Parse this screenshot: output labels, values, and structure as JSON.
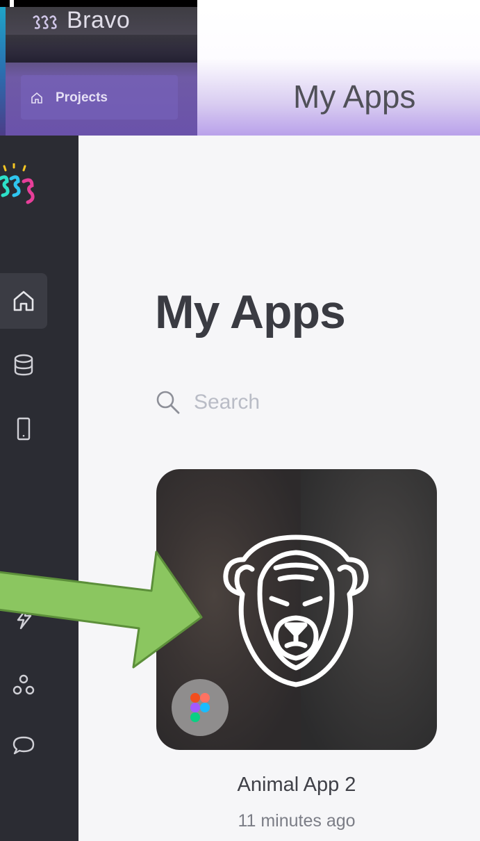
{
  "banner": {
    "brand": "Bravo",
    "projects_label": "Projects",
    "title": "My Apps"
  },
  "sidebar": {
    "items": [
      {
        "icon": "home-icon",
        "active": true
      },
      {
        "icon": "database-icon",
        "active": false
      },
      {
        "icon": "mobile-device-icon",
        "active": false
      },
      {
        "icon": "lightning-icon",
        "active": false
      },
      {
        "icon": "team-icon",
        "active": false
      },
      {
        "icon": "chat-icon",
        "active": false
      }
    ]
  },
  "main": {
    "title": "My Apps",
    "search": {
      "placeholder": "Search"
    },
    "apps": [
      {
        "name": "Animal App 2",
        "updated": "11 minutes ago",
        "badge_icon": "figma-icon"
      }
    ]
  },
  "colors": {
    "sidebar_bg": "#2b2c33",
    "main_bg": "#f6f6f8",
    "accent_purple": "#b9a1ea",
    "arrow_green": "#8bc660"
  }
}
